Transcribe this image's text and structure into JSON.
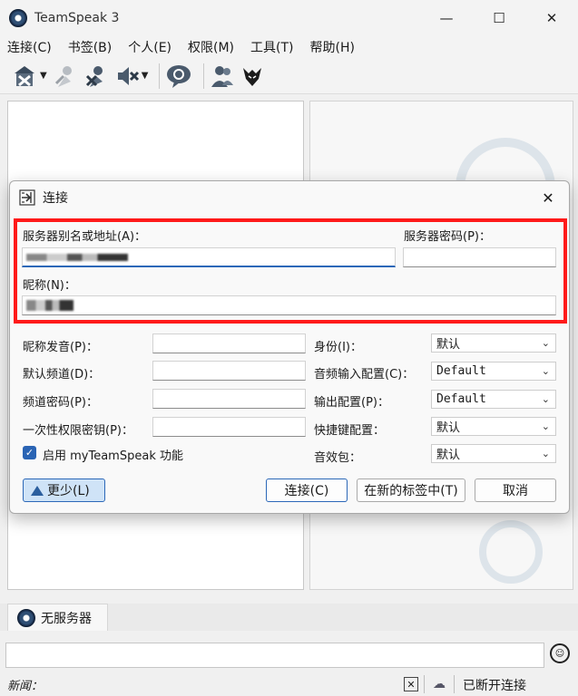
{
  "app": {
    "title": "TeamSpeak 3"
  },
  "window_controls": {
    "minimize": "—",
    "maximize": "☐",
    "close": "✕"
  },
  "menu": [
    "连接(C)",
    "书签(B)",
    "个人(E)",
    "权限(M)",
    "工具(T)",
    "帮助(H)"
  ],
  "toolbar": [
    "connect-icon",
    "disconnect-icon",
    "mute-mic-icon",
    "mute-speaker-icon",
    "chat-icon",
    "contacts-icon",
    "ts-wolf-icon"
  ],
  "dialog": {
    "title": "连接",
    "close": "✕",
    "server_label": "服务器别名或地址(A)：",
    "server_password_label": "服务器密码(P)：",
    "nickname_label": "昵称(N)：",
    "nickname_phonetic_label": "昵称发音(P)：",
    "default_channel_label": "默认频道(D)：",
    "channel_password_label": "频道密码(P)：",
    "one_time_key_label": "一次性权限密钥(P)：",
    "identity_label": "身份(I)：",
    "identity_value": "默认",
    "capture_label": "音频输入配置(C)：",
    "capture_value": "Default",
    "playback_label": "输出配置(P)：",
    "playback_value": "Default",
    "hotkey_label": "快捷键配置：",
    "hotkey_value": "默认",
    "soundpack_label": "音效包：",
    "soundpack_value": "默认",
    "myteamspeak_label": "启用 myTeamSpeak 功能",
    "myteamspeak_checked": true,
    "less_button": "更少(L)",
    "connect_button": "连接(C)",
    "new_tab_button": "在新的标签中(T)",
    "cancel_button": "取消"
  },
  "tabs": {
    "server_tab": "无服务器"
  },
  "status": {
    "news_label": "新闻：",
    "connection_status": "已断开连接"
  },
  "colors": {
    "highlight": "#ff1a1a",
    "accent": "#2c68b8",
    "checkbox": "#2a64b4"
  }
}
